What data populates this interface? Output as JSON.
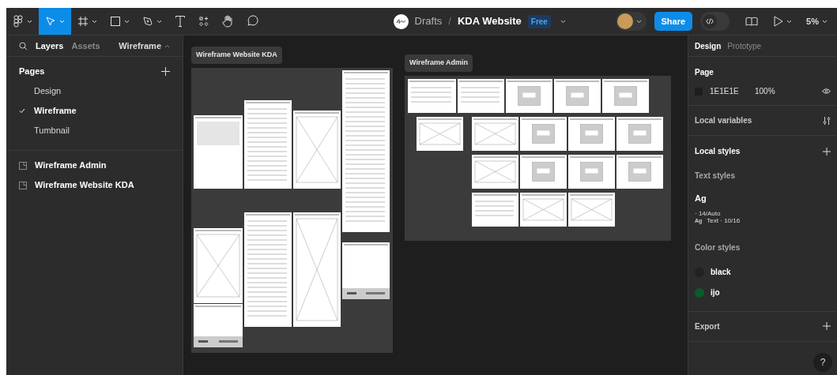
{
  "toolbar": {
    "tools": [
      {
        "kind": "menu",
        "selected": false,
        "caret": true
      },
      {
        "kind": "move",
        "selected": true,
        "caret": true
      },
      {
        "kind": "frame",
        "selected": false,
        "caret": true
      },
      {
        "kind": "shape",
        "selected": false,
        "caret": true
      },
      {
        "kind": "pen",
        "selected": false,
        "caret": true
      },
      {
        "kind": "text",
        "selected": false,
        "caret": false
      },
      {
        "kind": "resources",
        "selected": false,
        "caret": false
      },
      {
        "kind": "hand",
        "selected": false,
        "caret": false
      },
      {
        "kind": "comment",
        "selected": false,
        "caret": false
      }
    ],
    "breadcrumb": {
      "folder": "Drafts",
      "separator": "/",
      "file": "KDA Website",
      "badge": "Free"
    },
    "share": "Share",
    "dev_mode": false,
    "zoom": "5%"
  },
  "left_panel": {
    "tabs": [
      {
        "label": "Layers",
        "selected": true
      },
      {
        "label": "Assets",
        "selected": false
      }
    ],
    "page_switch": "Wireframe",
    "pages_title": "Pages",
    "pages": [
      {
        "label": "Design",
        "selected": false
      },
      {
        "label": "Wireframe",
        "selected": true
      },
      {
        "label": "Tumbnail",
        "selected": false
      }
    ],
    "layers": [
      {
        "label": "Wireframe Admin"
      },
      {
        "label": "Wireframe Website KDA"
      }
    ]
  },
  "canvas": {
    "frames": [
      {
        "kind": "website",
        "title": "Wireframe Website KDA"
      },
      {
        "kind": "admin",
        "title": "Wireframe Admin"
      }
    ]
  },
  "right_panel": {
    "tabs": [
      {
        "label": "Design",
        "selected": true
      },
      {
        "label": "Prototype",
        "selected": false
      }
    ],
    "page": {
      "title": "Page",
      "hex": "1E1E1E",
      "opacity": "100%"
    },
    "local_variables": "Local variables",
    "local_styles": "Local styles",
    "text_styles_title": "Text styles",
    "text_style": {
      "preview": "Ag",
      "line1": "· 14/Auto",
      "mini": "Ag",
      "line2": "Text · 10/16"
    },
    "color_styles_title": "Color styles",
    "color_styles": [
      {
        "name": "black",
        "color": "#1e2227"
      },
      {
        "name": "ijo",
        "color": "#0b5a2c"
      }
    ],
    "export": "Export",
    "help": "?"
  }
}
